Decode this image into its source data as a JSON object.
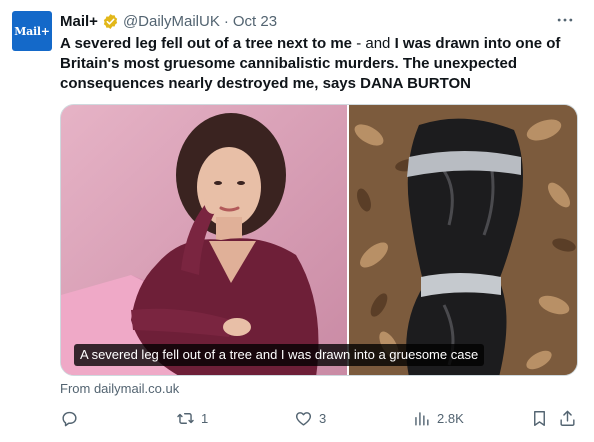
{
  "account": {
    "avatar_text": "Mail+",
    "display_name": "Mail+",
    "handle": "@DailyMailUK",
    "separator": "·",
    "date": "Oct 23",
    "verified_icon": "gold-verified-badge-icon",
    "brand_color": "#1469c9"
  },
  "post": {
    "text_bold_1": "A severed leg fell out of a tree next to me",
    "text_light": " - and ",
    "text_bold_2": "I was drawn into one of Britain's most gruesome cannibalistic murders. The unexpected consequences nearly destroyed me, says DANA BURTON"
  },
  "media": {
    "caption": "A severed leg fell out of a tree and I was drawn into a gruesome case",
    "left_image": "portrait-woman-pink-background",
    "right_image": "black-bag-taped-on-leaves"
  },
  "source": {
    "text": "From dailymail.co.uk"
  },
  "actions": {
    "reply": {
      "icon": "reply-icon",
      "count": ""
    },
    "repost": {
      "icon": "repost-icon",
      "count": "1"
    },
    "like": {
      "icon": "heart-icon",
      "count": "3"
    },
    "views": {
      "icon": "views-chart-icon",
      "count": "2.8K"
    },
    "bookmark": {
      "icon": "bookmark-icon"
    },
    "share": {
      "icon": "share-icon"
    }
  }
}
